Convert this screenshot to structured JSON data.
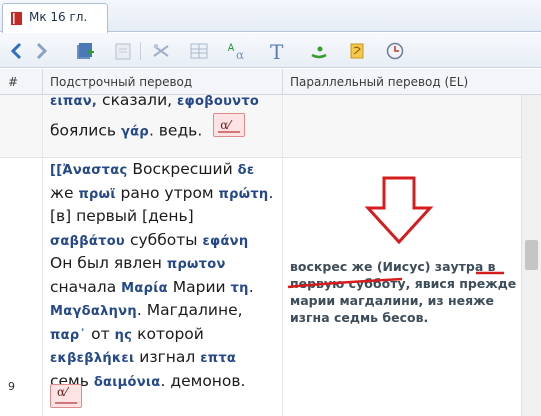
{
  "tab": {
    "label": "Мк 16 гл.",
    "icon": "book-icon"
  },
  "toolbar": {
    "icons": [
      "back-arrow-icon",
      "forward-arrow-icon",
      "add-bookmark-icon",
      "document-icon",
      "dictionary-icon",
      "table-icon",
      "alpha-omega-icon",
      "text-T-icon",
      "arabic-script-icon",
      "scroll-icon",
      "clock-icon"
    ]
  },
  "header": {
    "num": "#",
    "interlinear": "Подстрочный перевод",
    "parallel": "Параллельный перевод (EL)"
  },
  "row_prev": {
    "line1": {
      "g1": "ειπαν,",
      "r1": " сказали, ",
      "g2": "εφοβουντο"
    },
    "line2": {
      "r1": "боялись ",
      "g1": "γάρ",
      "r2": ". ведь."
    }
  },
  "row": {
    "number": "9",
    "lines": [
      {
        "parts": [
          [
            "g",
            "[[Ἀναστας"
          ],
          [
            "r",
            " Воскресший "
          ],
          [
            "g",
            "δε"
          ]
        ]
      },
      {
        "parts": [
          [
            "r",
            "же "
          ],
          [
            "g",
            "πρωϊ"
          ],
          [
            "r",
            " рано утром "
          ],
          [
            "g",
            "πρώτη"
          ],
          [
            "r",
            "."
          ]
        ]
      },
      {
        "parts": [
          [
            "r",
            "[в] первый [день]"
          ]
        ]
      },
      {
        "parts": [
          [
            "g",
            "σαββάτου"
          ],
          [
            "r",
            " субботы "
          ],
          [
            "g",
            "εφάνη"
          ]
        ]
      },
      {
        "parts": [
          [
            "r",
            "Он был явлен "
          ],
          [
            "g",
            "πρωτον"
          ]
        ]
      },
      {
        "parts": [
          [
            "r",
            "сначала "
          ],
          [
            "g",
            "Μαρία"
          ],
          [
            "r",
            " Марии "
          ],
          [
            "g",
            "τη"
          ],
          [
            "r",
            "."
          ]
        ]
      },
      {
        "parts": [
          [
            "g",
            "Μαγδαληνη"
          ],
          [
            "r",
            ". Магдалине,"
          ]
        ]
      },
      {
        "parts": [
          [
            "g",
            "παρ᾽"
          ],
          [
            "r",
            " от "
          ],
          [
            "g",
            "ης"
          ],
          [
            "r",
            " которой"
          ]
        ]
      },
      {
        "parts": [
          [
            "g",
            "εκβεβλήκει"
          ],
          [
            "r",
            " изгнал "
          ],
          [
            "g",
            "επτα"
          ]
        ]
      },
      {
        "parts": [
          [
            "r",
            "семь "
          ],
          [
            "g",
            "δαιμόνια"
          ],
          [
            "r",
            ". демонов."
          ]
        ]
      }
    ],
    "parallel": [
      "воскрес же (Иисус) заутра в",
      "первую субботу, явися прежде",
      "марии магдалини, из нeяже",
      "изгна седмь бесов."
    ]
  },
  "badge": "α⁄",
  "colors": {
    "greek": "#24488a",
    "annotation_red": "#d61c1c",
    "accent": "#2a7bd4"
  }
}
